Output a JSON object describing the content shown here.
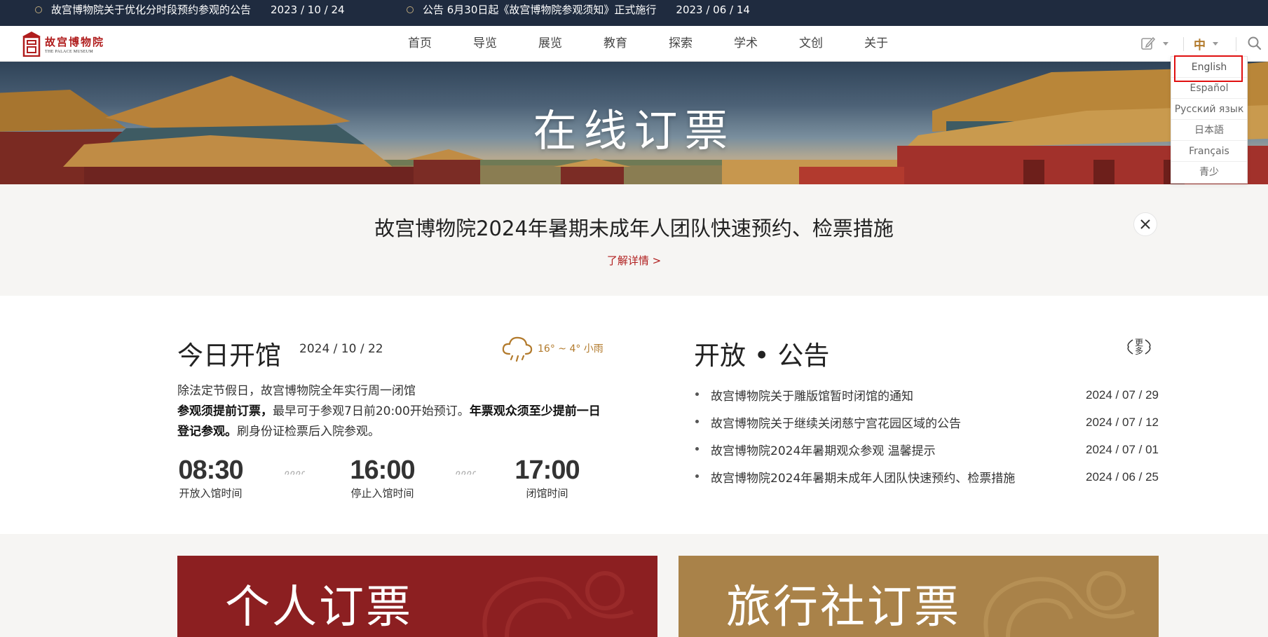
{
  "topbar": {
    "notices": [
      {
        "text": "故宫博物院关于优化分时段预约参观的公告",
        "date": "2023 / 10 / 24"
      },
      {
        "text": "公告 6月30日起《故宫博物院参观须知》正式施行",
        "date": "2023 / 06 / 14"
      }
    ]
  },
  "header": {
    "logo_cn": "故宫博物院",
    "logo_en": "THE PALACE MUSEUM",
    "nav": [
      "首页",
      "导览",
      "展览",
      "教育",
      "探索",
      "学术",
      "文创",
      "关于"
    ],
    "lang_current": "中"
  },
  "lang_menu": [
    "English",
    "Español",
    "Русский язык",
    "日本語",
    "Français",
    "青少"
  ],
  "banner": {
    "title": "在线订票"
  },
  "notice_strip": {
    "title": "故宫博物院2024年暑期未成年人团队快速预约、检票措施",
    "link": "了解详情 >"
  },
  "today": {
    "title": "今日开馆",
    "date": "2024 / 10 / 22",
    "weather": "16° ~ 4° 小雨",
    "line1": "除法定节假日，故宫博物院全年实行周一闭馆",
    "line2_bold1": "参观须提前订票，",
    "line2_normal": "最早可于参观7日前20:00开始预订。",
    "line2_bold2": "年票观众须至少提前一日登记参观。",
    "line3": "刷身份证检票后入院参观。",
    "times": [
      {
        "value": "08:30",
        "label": "开放入馆时间"
      },
      {
        "value": "16:00",
        "label": "停止入馆时间"
      },
      {
        "value": "17:00",
        "label": "闭馆时间"
      }
    ]
  },
  "announcements": {
    "title": "开放 • 公告",
    "more": "更多",
    "items": [
      {
        "text": "故宫博物院关于雕版馆暂时闭馆的通知",
        "date": "2024 / 07 / 29"
      },
      {
        "text": "故宫博物院关于继续关闭慈宁宫花园区域的公告",
        "date": "2024 / 07 / 12"
      },
      {
        "text": "故宫博物院2024年暑期观众参观 温馨提示",
        "date": "2024 / 07 / 01"
      },
      {
        "text": "故宫博物院2024年暑期未成年人团队快速预约、检票措施",
        "date": "2024 / 06 / 25"
      }
    ]
  },
  "cards": {
    "personal": "个人订票",
    "agency": "旅行社订票"
  },
  "colors": {
    "topbar": "#1f2b3f",
    "accent_red": "#b01d1d",
    "gold": "#b27a2c",
    "card_red": "#8c1f21",
    "card_gold": "#a98249"
  }
}
